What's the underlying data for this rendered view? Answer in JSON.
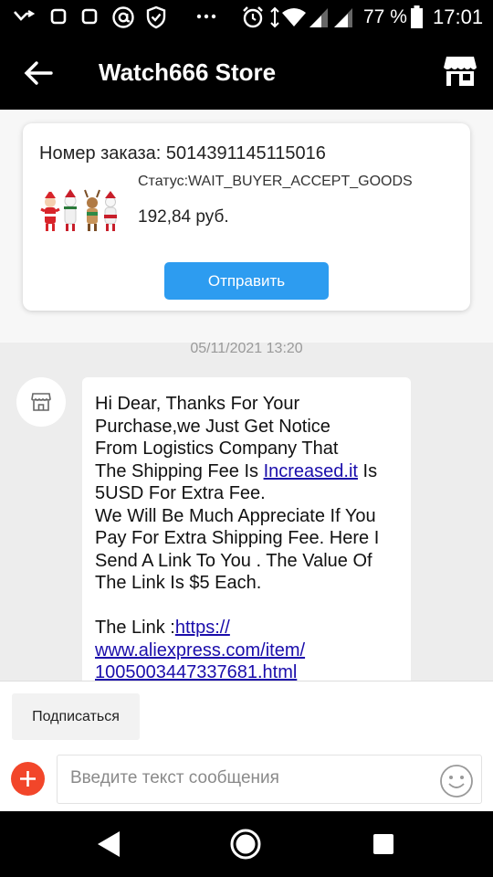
{
  "status_bar": {
    "battery_percent": "77 %",
    "time": "17:01",
    "icons": [
      "missed-call-icon",
      "notification-square-icon",
      "notification-square-icon",
      "at-sign-icon",
      "shield-check-icon",
      "more-dots-icon",
      "alarm-icon",
      "data-arrows-icon",
      "wifi-icon",
      "signal-icon",
      "signal-icon",
      "battery-icon"
    ]
  },
  "header": {
    "title": "Watch666 Store",
    "back_icon": "back-arrow-icon",
    "store_icon": "store-icon"
  },
  "order": {
    "number_label": "Номер заказа: 5014391145115016",
    "status": "Статус:WAIT_BUYER_ACCEPT_GOODS",
    "price": "192,84 руб.",
    "send_label": "Отправить"
  },
  "chat": {
    "timestamp": "05/11/2021 13:20",
    "message_lines": [
      "Hi Dear, Thanks For Your",
      "Purchase,we Just Get Notice",
      "From Logistics Company That"
    ],
    "line4_prefix": "The Shipping Fee Is ",
    "line4_link": "Increased.it",
    "line4_suffix": " Is",
    "lines_after": [
      "5USD For Extra Fee.",
      "We Will Be Much Appreciate If You",
      "Pay For Extra Shipping Fee. Here I",
      "Send A Link To You . The Value Of",
      "The Link Is $5 Each."
    ],
    "link_prefix": "The Link :",
    "link_line1": "https://",
    "link_line2": "www.aliexpress.com/item/",
    "link_line3": "1005003447337681.html"
  },
  "footer": {
    "subscribe_label": "Подписаться",
    "input_placeholder": "Введите текст сообщения"
  },
  "colors": {
    "accent_blue": "#2d9cf0",
    "add_button_red": "#f2462a",
    "link": "#1a0dab"
  }
}
